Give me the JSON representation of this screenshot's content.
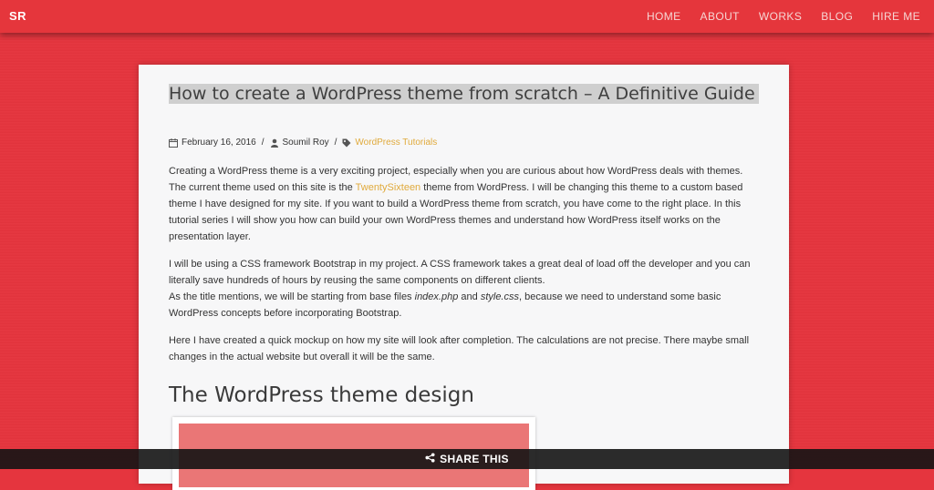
{
  "header": {
    "brand": "SR",
    "nav": [
      {
        "label": "HOME"
      },
      {
        "label": "ABOUT"
      },
      {
        "label": "WORKS"
      },
      {
        "label": "BLOG"
      },
      {
        "label": "HIRE ME"
      }
    ]
  },
  "post": {
    "title": "How to create a WordPress theme from scratch – A Definitive Guide",
    "date": "February 16, 2016",
    "author": "Soumil Roy",
    "category": "WordPress Tutorials",
    "p1_before_link": "Creating a WordPress theme is a very exciting project, especially when you are curious about how WordPress deals with themes. The current theme used on this site is the ",
    "p1_link": "TwentySixteen",
    "p1_after_link": " theme from WordPress. I will be changing this theme to a custom based theme I have designed for my site. If you want to build a WordPress theme from scratch, you have come to the right place. In this tutorial series I will show you how can build your own WordPress themes and understand how WordPress itself works on the presentation layer.",
    "p2_line1": "I will be using a CSS framework Bootstrap in my project. A CSS framework takes a great deal of load off the developer and you can literally save hundreds of hours by reusing the same components on different clients.",
    "p2_line2_a": "As the title mentions, we will be starting from base files ",
    "p2_file1": "index.php",
    "p2_and": " and ",
    "p2_file2": "style.css",
    "p2_line2_b": ", because we need to understand some basic WordPress concepts before incorporating Bootstrap.",
    "p3": "Here I have created a quick mockup on how my site will look after completion. The calculations are not precise.  There maybe small changes in the actual website but overall it will be the same.",
    "section_heading": "The WordPress theme design"
  },
  "share": {
    "label": "SHARE THIS",
    "icon": "share-icon"
  },
  "colors": {
    "background": "#e5353e",
    "accent_link": "#e0aa3c",
    "card": "#f7f7f8"
  }
}
